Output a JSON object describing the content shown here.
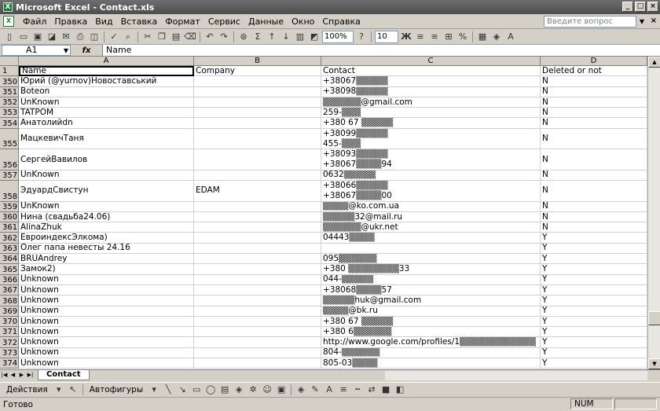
{
  "window": {
    "title": "Microsoft Excel - Contact.xls"
  },
  "menu": {
    "items": [
      "Файл",
      "Правка",
      "Вид",
      "Вставка",
      "Формат",
      "Сервис",
      "Данные",
      "Окно",
      "Справка"
    ],
    "help_placeholder": "Введите вопрос"
  },
  "toolbar": {
    "zoom": "100%",
    "font_size": "10",
    "bold": "Ж"
  },
  "formula_bar": {
    "name_box": "A1",
    "fx": "fx",
    "content": "Name"
  },
  "columns": [
    {
      "label": "A"
    },
    {
      "label": "B"
    },
    {
      "label": "C"
    },
    {
      "label": "D"
    }
  ],
  "header_row": {
    "num": "1",
    "a": "Name",
    "b": "Company",
    "c": "Contact",
    "d": "Deleted or not"
  },
  "rows": [
    {
      "num": "350",
      "a": "Юрий (@yurnov)Новоставський",
      "b": "",
      "c": [
        "+38067▒▒▒▒▒"
      ],
      "d": "N"
    },
    {
      "num": "351",
      "a": "Boteon",
      "b": "",
      "c": [
        "+38098▒▒▒▒▒"
      ],
      "d": "N"
    },
    {
      "num": "352",
      "a": "UnKnown",
      "b": "",
      "c": [
        "▒▒▒▒▒▒@gmail.com"
      ],
      "d": "N"
    },
    {
      "num": "353",
      "a": "TATPOM",
      "b": "",
      "c": [
        "259-▒▒▒"
      ],
      "d": "N"
    },
    {
      "num": "354",
      "a": "Анатолийdn",
      "b": "",
      "c": [
        "+380 67 ▒▒▒▒▒"
      ],
      "d": "N"
    },
    {
      "num": "355",
      "a": "МацкевичТаня",
      "b": "",
      "c": [
        "+38099▒▒▒▒▒",
        "455-▒▒▒"
      ],
      "d": "N",
      "tall": true
    },
    {
      "num": "356",
      "a": "СергейВавилов",
      "b": "",
      "c": [
        "+38093▒▒▒▒▒",
        "+38067▒▒▒▒94"
      ],
      "d": "N",
      "tall": true
    },
    {
      "num": "357",
      "a": "UnKnown",
      "b": "",
      "c": [
        "0632▒▒▒▒▒"
      ],
      "d": "N"
    },
    {
      "num": "358",
      "a": "ЭдуардСвистун",
      "b": "EDAM",
      "c": [
        "+38066▒▒▒▒▒",
        "+38067▒▒▒▒00"
      ],
      "d": "N",
      "tall": true
    },
    {
      "num": "359",
      "a": "UnKnown",
      "b": "",
      "c": [
        "▒▒▒▒@ko.com.ua"
      ],
      "d": "N"
    },
    {
      "num": "360",
      "a": "Нина (свадьба24.06)",
      "b": "",
      "c": [
        "▒▒▒▒▒32@mail.ru"
      ],
      "d": "N"
    },
    {
      "num": "361",
      "a": "AlinaZhuk",
      "b": "",
      "c": [
        "▒▒▒▒▒▒@ukr.net"
      ],
      "d": "N"
    },
    {
      "num": "362",
      "a": "ЕвроиндексЭлкома)",
      "b": "",
      "c": [
        "04443▒▒▒▒"
      ],
      "d": "Y"
    },
    {
      "num": "363",
      "a": "Олег папа невесты 24.16",
      "b": "",
      "c": [
        ""
      ],
      "d": "Y"
    },
    {
      "num": "364",
      "a": "BRUAndrey",
      "b": "",
      "c": [
        "095▒▒▒▒▒▒"
      ],
      "d": "Y"
    },
    {
      "num": "365",
      "a": "Замок2)",
      "b": "",
      "c": [
        "+380 ▒▒▒▒▒▒▒▒33"
      ],
      "d": "Y"
    },
    {
      "num": "366",
      "a": "Unknown",
      "b": "",
      "c": [
        "044-▒▒▒▒▒"
      ],
      "d": "Y"
    },
    {
      "num": "367",
      "a": "Unknown",
      "b": "",
      "c": [
        "+38068▒▒▒▒57"
      ],
      "d": "Y"
    },
    {
      "num": "368",
      "a": "Unknown",
      "b": "",
      "c": [
        "▒▒▒▒▒huk@gmail.com"
      ],
      "d": "Y"
    },
    {
      "num": "369",
      "a": "Unknown",
      "b": "",
      "c": [
        "▒▒▒▒@bk.ru"
      ],
      "d": "Y"
    },
    {
      "num": "370",
      "a": "Unknown",
      "b": "",
      "c": [
        "+380 67 ▒▒▒▒▒"
      ],
      "d": "Y"
    },
    {
      "num": "371",
      "a": "Unknown",
      "b": "",
      "c": [
        "+380 6▒▒▒▒▒▒"
      ],
      "d": "Y"
    },
    {
      "num": "372",
      "a": "Unknown",
      "b": "",
      "c": [
        "http://www.google.com/profiles/1▒▒▒▒▒▒▒▒▒▒▒▒"
      ],
      "d": "Y"
    },
    {
      "num": "373",
      "a": "Unknown",
      "b": "",
      "c": [
        "804-▒▒▒▒▒▒"
      ],
      "d": "Y"
    },
    {
      "num": "374",
      "a": "Unknown",
      "b": "",
      "c": [
        "805-03▒▒▒▒"
      ],
      "d": "Y"
    }
  ],
  "sheet_tab": "Contact",
  "draw_toolbar": {
    "actions": "Действия",
    "autoshapes": "Автофигуры"
  },
  "status": {
    "ready": "Готово",
    "num": "NUM"
  }
}
